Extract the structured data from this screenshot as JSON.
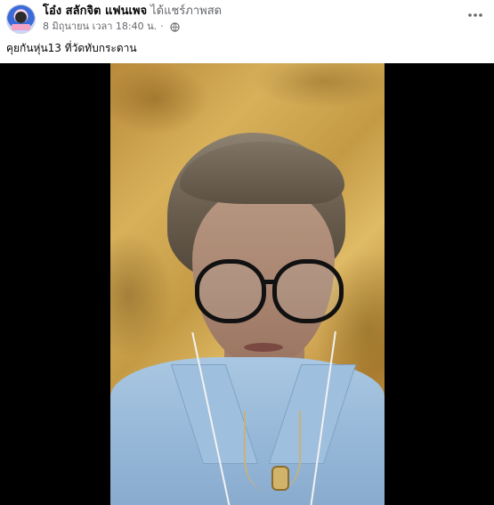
{
  "post": {
    "author": "โอ๋ง สลักจิต แฟนเพจ",
    "action": "ได้แชร์ภาพสด",
    "timestamp": "8 มิถุนายน เวลา 18:40 น.",
    "separator": "·",
    "privacy_icon": "globe-icon",
    "more_icon": "more-options-icon",
    "caption": "คุยกันหุ่น13 ที่วัดทับกระดาน"
  },
  "colors": {
    "text": "#050505",
    "secondary": "#65676b",
    "video_bg": "#000000"
  }
}
